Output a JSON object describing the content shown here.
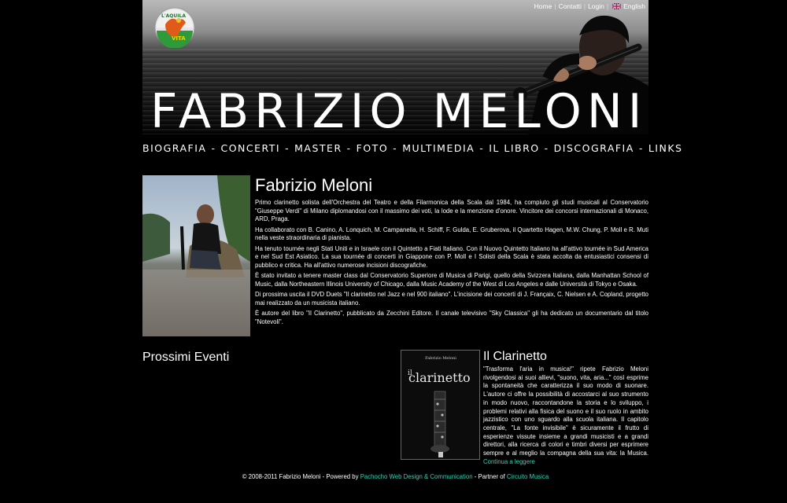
{
  "header": {
    "top_links": [
      {
        "label": "Home"
      },
      {
        "label": "Contatti"
      },
      {
        "label": "Login"
      },
      {
        "label": "English"
      }
    ],
    "logo_text": "L'AQUILA per la VITA",
    "site_title": "FABRIZIO MELONI",
    "flag_icon": "uk-flag-icon"
  },
  "nav": {
    "items": [
      {
        "label": "BIOGRAFIA"
      },
      {
        "label": "CONCERTI"
      },
      {
        "label": "MASTER"
      },
      {
        "label": "FOTO"
      },
      {
        "label": "MULTIMEDIA"
      },
      {
        "label": "IL LIBRO"
      },
      {
        "label": "DISCOGRAFIA"
      },
      {
        "label": "LINKS"
      }
    ],
    "separator": "-"
  },
  "bio": {
    "title": "Fabrizio Meloni",
    "paragraphs": [
      "Primo clarinetto solista dell'Orchestra del Teatro e della Filarmonica della Scala dal 1984, ha compiuto gli studi musicali al Conservatorio \"Giuseppe Verdi\" di Milano diplomandosi con il massimo dei voti, la lode e la menzione d'onore. Vincitore dei concorsi internazionali di Monaco, ARD, Praga.",
      "Ha collaborato con B. Canino, A. Lonquich, M. Campanella, H. Schiff, F. Gulda, E. Gruberova, il Quartetto Hagen, M.W. Chung, P. Moll e R. Muti nella veste straordinaria di pianista.",
      "Ha tenuto tournée negli Stati Uniti e in Israele con il Quintetto a Fiati Italiano. Con il Nuovo Quintetto Italiano ha all'attivo tournée in Sud America e nel Sud Est Asiatico. La sua tournée di concerti in Giappone con P. Moll e I Solisti della Scala è stata accolta da entusiastici consensi di pubblico e critica. Ha all'attivo numerose incisioni discografiche.",
      "È stato invitato a tenere master class dal Conservatorio Superiore di Musica di Parigi, quello della Svizzera Italiana, dalla Manhattan School of Music, dalla Northeastern Illinois University of Chicago, dalla Music Academy of the West di Los Angeles e dalle Università di Tokyo e Osaka.",
      "Di prossima uscita il DVD Duets \"Il clarinetto nel Jazz e nel 900 italiano\". L'incisione dei concerti di J. Françaix, C. Nielsen e A. Copland, progetto mai realizzato da un musicista italiano.",
      "È autore del libro \"Il Clarinetto\", pubblicato da Zecchini Editore. Il canale televisivo \"Sky Classica\" gli ha dedicato un documentario dal titolo \"Notevoli\"."
    ]
  },
  "events": {
    "title": "Prossimi Eventi"
  },
  "book": {
    "title": "Il Clarinetto",
    "cover_author": "Fabrizio Meloni",
    "cover_title_prefix": "il",
    "cover_title": "clarinetto",
    "text": "\"Trasforma l'aria in musica!\" ripete Fabrizio Meloni rivolgendosi ai suoi allievi, \"suono, vita, aria...\" così esprime la spontaneità che caratterizza il suo modo di suonare. L'autore ci offre la possibilità di accostarci al suo strumento in modo nuovo, raccontandone la storia e lo sviluppo, i problemi relativi alla fisica del suono e il suo ruolo in ambito jazzistico con uno sguardo alla scuola italiana. Il capitolo centrale, \"La fonte invisibile\" è sicuramente il frutto di esperienze vissute insieme a grandi musicisti e a grandi direttori, alla ricerca di colori e timbri diversi per esprimere sempre e al meglio la compagna della sua vita: la Musica.",
    "read_more": "Continua a leggere"
  },
  "footer": {
    "prefix": "© 2008-2011 Fabrizio Meloni - Powered by",
    "powered_link": "Pachocho Web Design & Communication",
    "middle": "- Partner of",
    "partner_link": "Circuito Musica"
  },
  "colors": {
    "background": "#000000",
    "link_accent": "#2fd3b4"
  }
}
